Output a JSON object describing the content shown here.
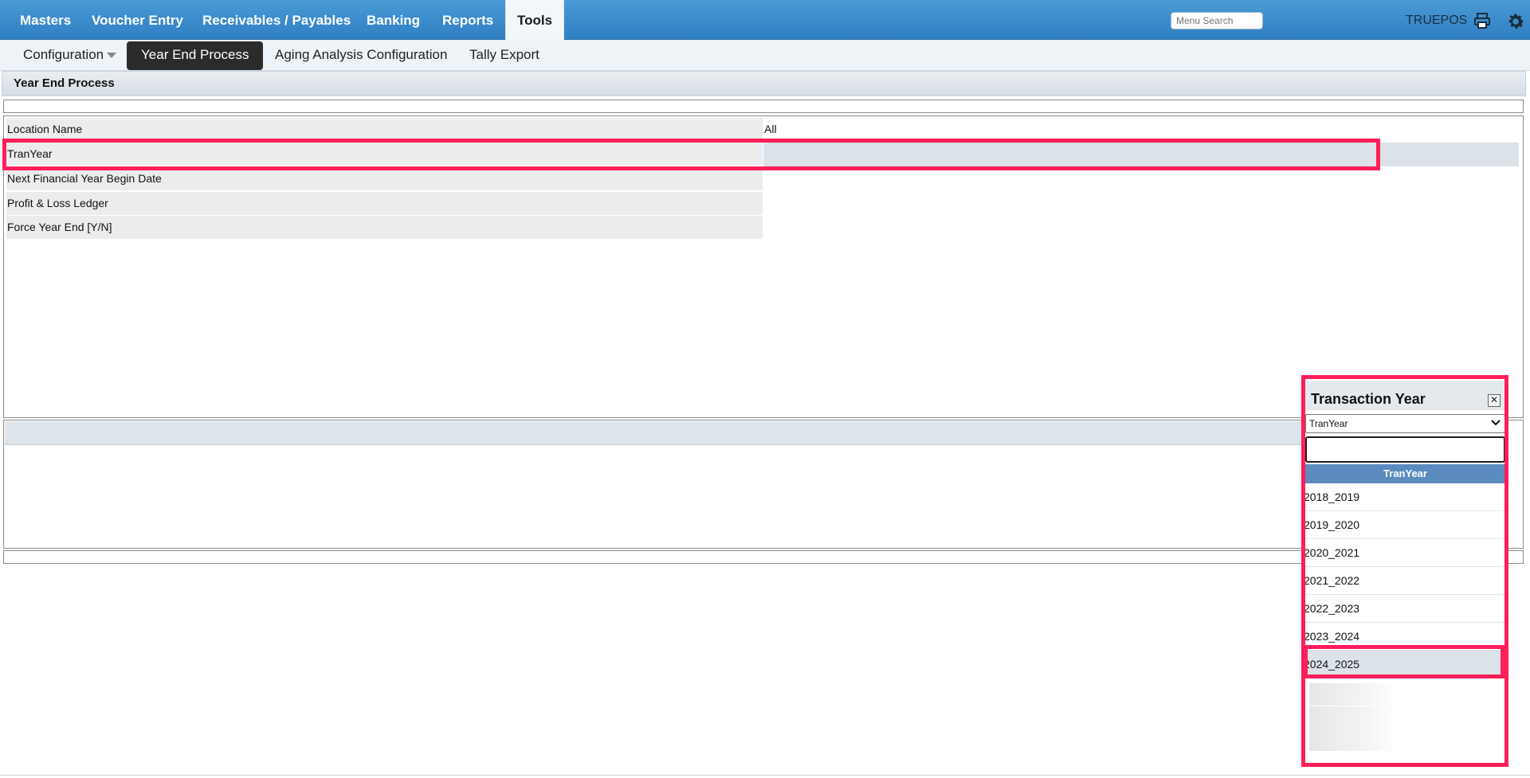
{
  "nav": {
    "items": [
      "Masters",
      "Voucher Entry",
      "Receivables / Payables",
      "Banking",
      "Reports",
      "Tools"
    ],
    "search_placeholder": "Menu Search",
    "user": "TRUEPOS",
    "icons": [
      "printer-icon",
      "gear-icon"
    ]
  },
  "subnav": {
    "items": [
      "Configuration",
      "Year End Process",
      "Aging Analysis Configuration",
      "Tally Export"
    ]
  },
  "panel": {
    "title": "Year End Process"
  },
  "form": {
    "rows": [
      {
        "label": "Location Name",
        "value": "All"
      },
      {
        "label": "TranYear",
        "value": ""
      },
      {
        "label": "Next Financial Year Begin Date",
        "value": ""
      },
      {
        "label": "Profit & Loss Ledger",
        "value": ""
      },
      {
        "label": "Force Year End [Y/N]",
        "value": ""
      }
    ]
  },
  "popup": {
    "title": "Transaction Year",
    "close_glyph": "✕",
    "select_value": "TranYear",
    "column_header": "TranYear",
    "rows": [
      "2018_2019",
      "2019_2020",
      "2020_2021",
      "2021_2022",
      "2022_2023",
      "2023_2024",
      "2024_2025"
    ],
    "selected": "2024_2025"
  },
  "colors": {
    "nav_blue": "#2f7fc3",
    "highlight": "#ff1f5a",
    "header_blue": "#5c8cbf"
  }
}
